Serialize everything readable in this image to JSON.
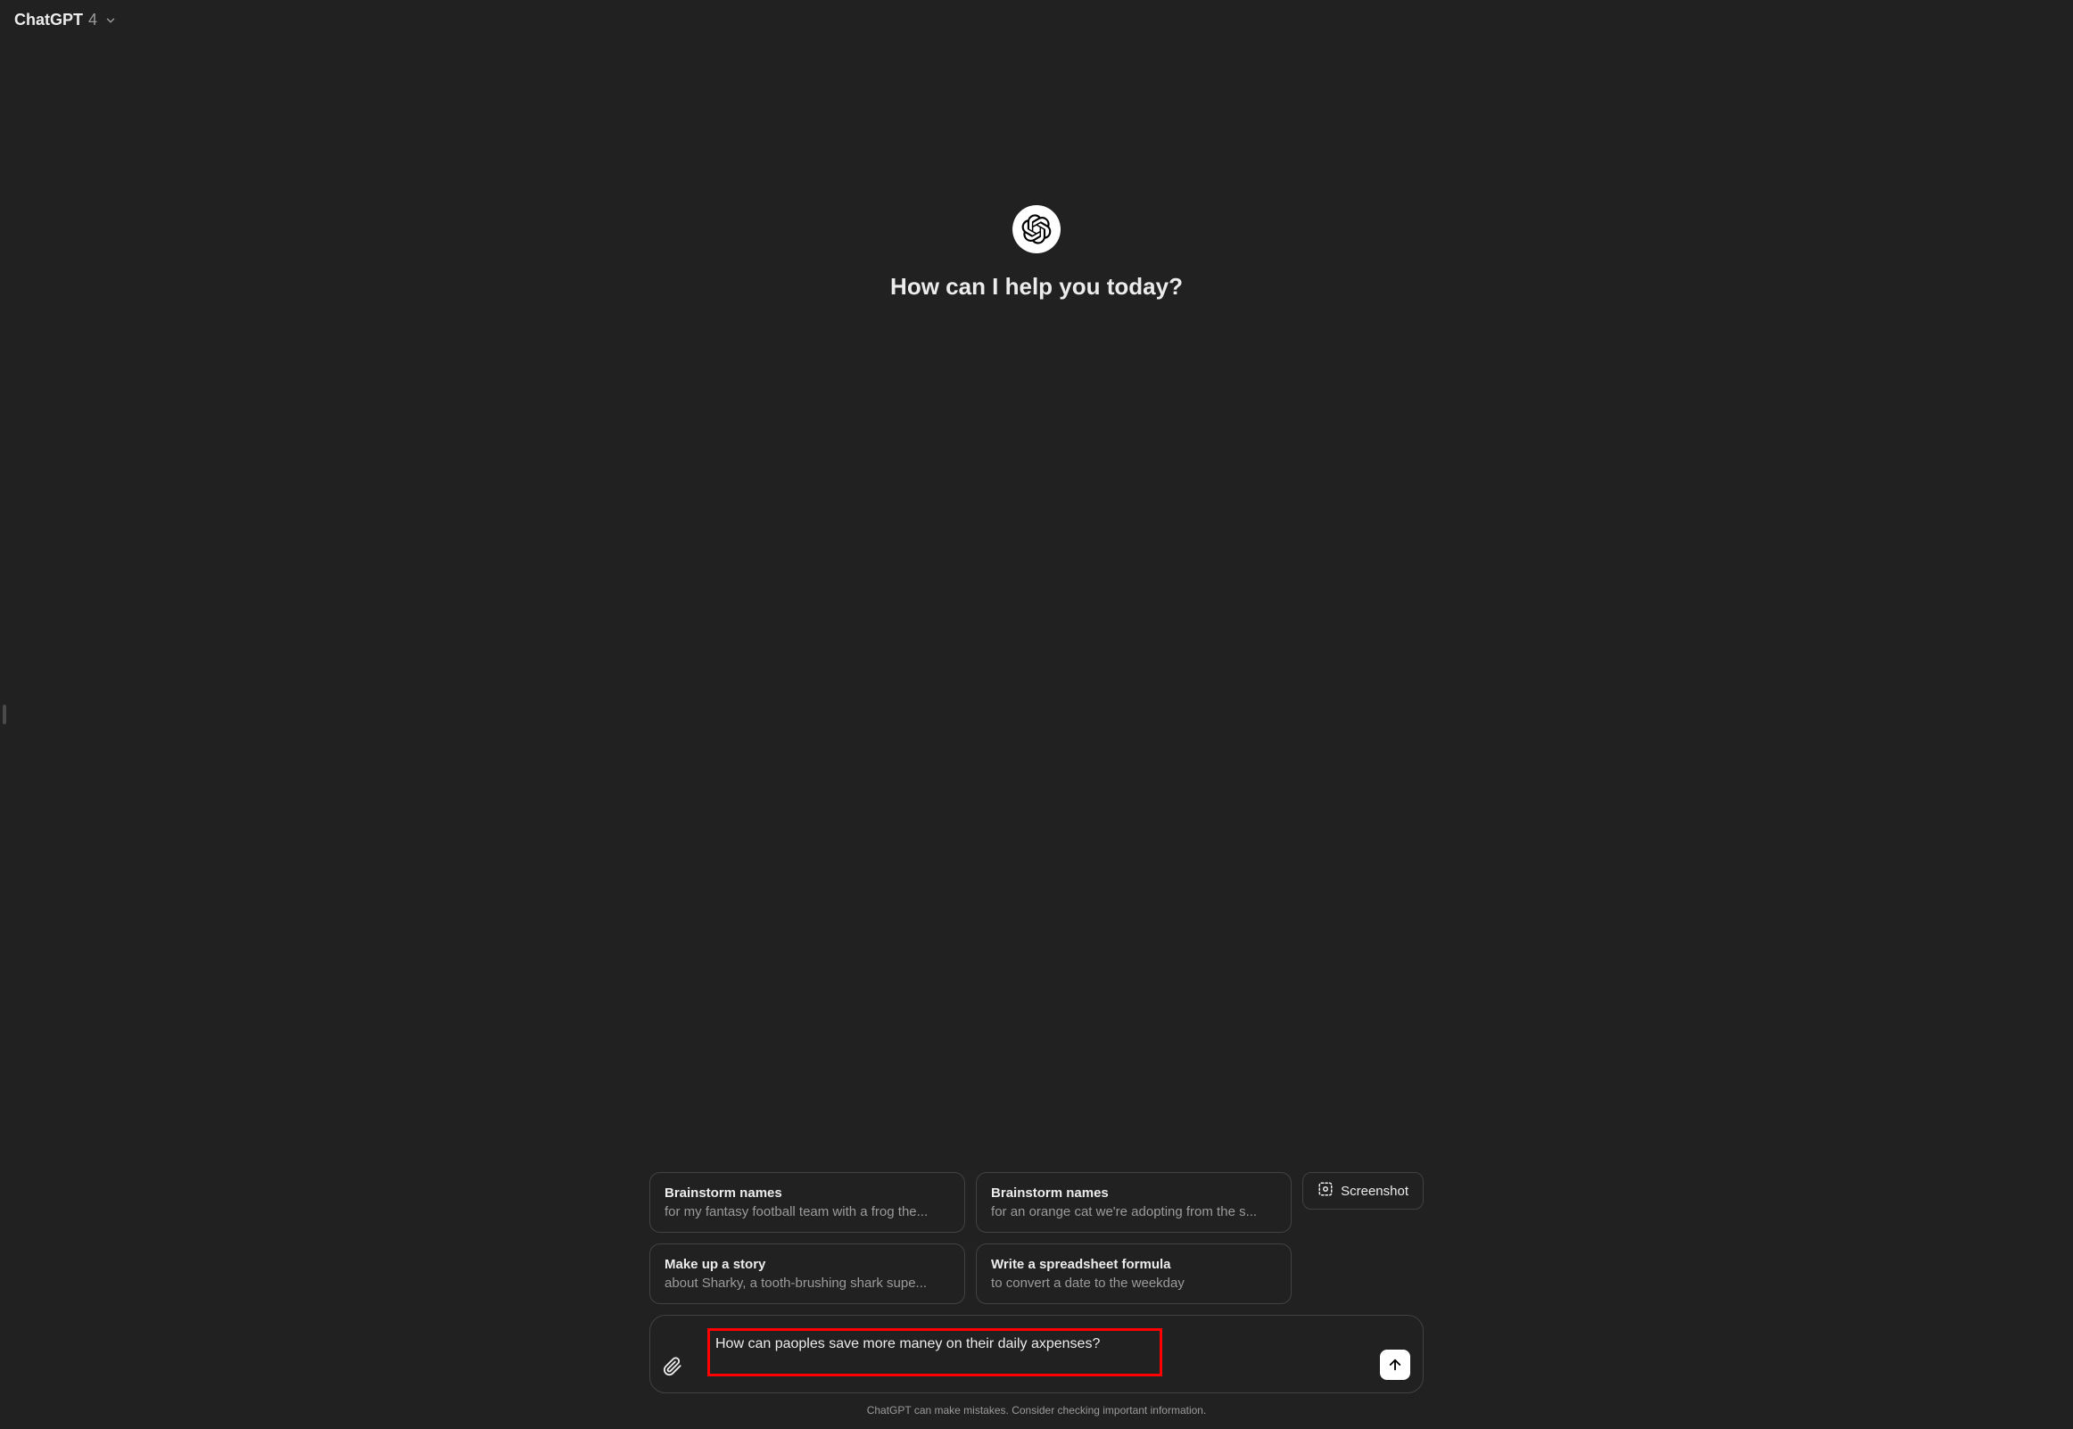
{
  "header": {
    "title": "ChatGPT",
    "version": "4"
  },
  "hero": {
    "greeting": "How can I help you today?"
  },
  "suggestions": [
    {
      "title": "Brainstorm names",
      "sub": "for my fantasy football team with a frog the..."
    },
    {
      "title": "Brainstorm names",
      "sub": "for an orange cat we're adopting from the s..."
    },
    {
      "title": "Make up a story",
      "sub": "about Sharky, a tooth-brushing shark supe..."
    },
    {
      "title": "Write a spreadsheet formula",
      "sub": "to convert a date to the weekday"
    }
  ],
  "screenshot_button": "Screenshot",
  "input": {
    "value": "How can paoples save more maney on their daily axpenses?"
  },
  "footer": {
    "disclaimer": "ChatGPT can make mistakes. Consider checking important information."
  }
}
